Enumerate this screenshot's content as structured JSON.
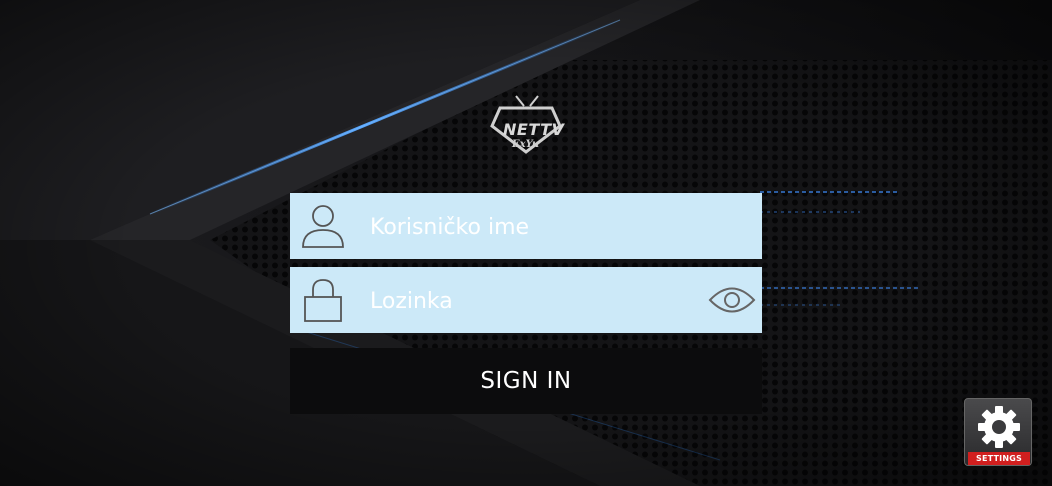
{
  "app": {
    "logo_line1": "NETTV",
    "logo_line2": "ExYu"
  },
  "login": {
    "username_placeholder": "Korisničko ime",
    "password_placeholder": "Lozinka",
    "sign_in_label": "SIGN IN"
  },
  "settings": {
    "label": "SETTINGS"
  },
  "icons": {
    "username": "user-icon",
    "password": "lock-icon",
    "show_password": "eye-icon",
    "settings": "gear-icon"
  },
  "colors": {
    "field_background": "#cce9f8",
    "button_background": "#0c0c0d",
    "accent_blue": "#2f8cff",
    "settings_badge": "#d11f1f"
  }
}
